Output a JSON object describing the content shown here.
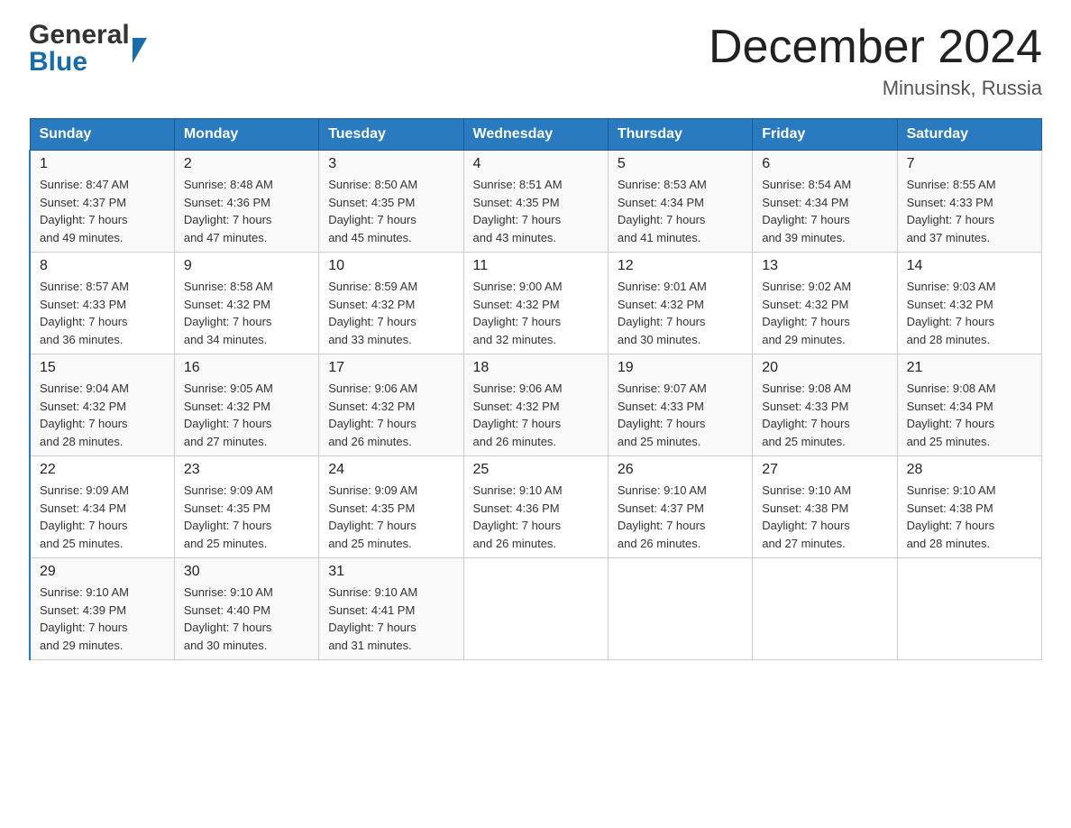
{
  "logo": {
    "general": "General",
    "blue": "Blue"
  },
  "header": {
    "title": "December 2024",
    "location": "Minusinsk, Russia"
  },
  "days_of_week": [
    "Sunday",
    "Monday",
    "Tuesday",
    "Wednesday",
    "Thursday",
    "Friday",
    "Saturday"
  ],
  "weeks": [
    [
      {
        "day": "1",
        "info": "Sunrise: 8:47 AM\nSunset: 4:37 PM\nDaylight: 7 hours\nand 49 minutes."
      },
      {
        "day": "2",
        "info": "Sunrise: 8:48 AM\nSunset: 4:36 PM\nDaylight: 7 hours\nand 47 minutes."
      },
      {
        "day": "3",
        "info": "Sunrise: 8:50 AM\nSunset: 4:35 PM\nDaylight: 7 hours\nand 45 minutes."
      },
      {
        "day": "4",
        "info": "Sunrise: 8:51 AM\nSunset: 4:35 PM\nDaylight: 7 hours\nand 43 minutes."
      },
      {
        "day": "5",
        "info": "Sunrise: 8:53 AM\nSunset: 4:34 PM\nDaylight: 7 hours\nand 41 minutes."
      },
      {
        "day": "6",
        "info": "Sunrise: 8:54 AM\nSunset: 4:34 PM\nDaylight: 7 hours\nand 39 minutes."
      },
      {
        "day": "7",
        "info": "Sunrise: 8:55 AM\nSunset: 4:33 PM\nDaylight: 7 hours\nand 37 minutes."
      }
    ],
    [
      {
        "day": "8",
        "info": "Sunrise: 8:57 AM\nSunset: 4:33 PM\nDaylight: 7 hours\nand 36 minutes."
      },
      {
        "day": "9",
        "info": "Sunrise: 8:58 AM\nSunset: 4:32 PM\nDaylight: 7 hours\nand 34 minutes."
      },
      {
        "day": "10",
        "info": "Sunrise: 8:59 AM\nSunset: 4:32 PM\nDaylight: 7 hours\nand 33 minutes."
      },
      {
        "day": "11",
        "info": "Sunrise: 9:00 AM\nSunset: 4:32 PM\nDaylight: 7 hours\nand 32 minutes."
      },
      {
        "day": "12",
        "info": "Sunrise: 9:01 AM\nSunset: 4:32 PM\nDaylight: 7 hours\nand 30 minutes."
      },
      {
        "day": "13",
        "info": "Sunrise: 9:02 AM\nSunset: 4:32 PM\nDaylight: 7 hours\nand 29 minutes."
      },
      {
        "day": "14",
        "info": "Sunrise: 9:03 AM\nSunset: 4:32 PM\nDaylight: 7 hours\nand 28 minutes."
      }
    ],
    [
      {
        "day": "15",
        "info": "Sunrise: 9:04 AM\nSunset: 4:32 PM\nDaylight: 7 hours\nand 28 minutes."
      },
      {
        "day": "16",
        "info": "Sunrise: 9:05 AM\nSunset: 4:32 PM\nDaylight: 7 hours\nand 27 minutes."
      },
      {
        "day": "17",
        "info": "Sunrise: 9:06 AM\nSunset: 4:32 PM\nDaylight: 7 hours\nand 26 minutes."
      },
      {
        "day": "18",
        "info": "Sunrise: 9:06 AM\nSunset: 4:32 PM\nDaylight: 7 hours\nand 26 minutes."
      },
      {
        "day": "19",
        "info": "Sunrise: 9:07 AM\nSunset: 4:33 PM\nDaylight: 7 hours\nand 25 minutes."
      },
      {
        "day": "20",
        "info": "Sunrise: 9:08 AM\nSunset: 4:33 PM\nDaylight: 7 hours\nand 25 minutes."
      },
      {
        "day": "21",
        "info": "Sunrise: 9:08 AM\nSunset: 4:34 PM\nDaylight: 7 hours\nand 25 minutes."
      }
    ],
    [
      {
        "day": "22",
        "info": "Sunrise: 9:09 AM\nSunset: 4:34 PM\nDaylight: 7 hours\nand 25 minutes."
      },
      {
        "day": "23",
        "info": "Sunrise: 9:09 AM\nSunset: 4:35 PM\nDaylight: 7 hours\nand 25 minutes."
      },
      {
        "day": "24",
        "info": "Sunrise: 9:09 AM\nSunset: 4:35 PM\nDaylight: 7 hours\nand 25 minutes."
      },
      {
        "day": "25",
        "info": "Sunrise: 9:10 AM\nSunset: 4:36 PM\nDaylight: 7 hours\nand 26 minutes."
      },
      {
        "day": "26",
        "info": "Sunrise: 9:10 AM\nSunset: 4:37 PM\nDaylight: 7 hours\nand 26 minutes."
      },
      {
        "day": "27",
        "info": "Sunrise: 9:10 AM\nSunset: 4:38 PM\nDaylight: 7 hours\nand 27 minutes."
      },
      {
        "day": "28",
        "info": "Sunrise: 9:10 AM\nSunset: 4:38 PM\nDaylight: 7 hours\nand 28 minutes."
      }
    ],
    [
      {
        "day": "29",
        "info": "Sunrise: 9:10 AM\nSunset: 4:39 PM\nDaylight: 7 hours\nand 29 minutes."
      },
      {
        "day": "30",
        "info": "Sunrise: 9:10 AM\nSunset: 4:40 PM\nDaylight: 7 hours\nand 30 minutes."
      },
      {
        "day": "31",
        "info": "Sunrise: 9:10 AM\nSunset: 4:41 PM\nDaylight: 7 hours\nand 31 minutes."
      },
      {
        "day": "",
        "info": ""
      },
      {
        "day": "",
        "info": ""
      },
      {
        "day": "",
        "info": ""
      },
      {
        "day": "",
        "info": ""
      }
    ]
  ]
}
